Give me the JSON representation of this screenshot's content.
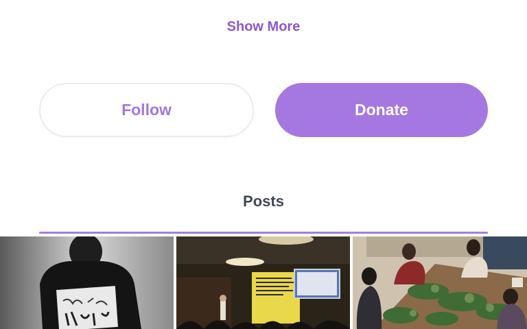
{
  "actions": {
    "show_more_label": "Show More",
    "follow_label": "Follow",
    "donate_label": "Donate"
  },
  "posts": {
    "section_title": "Posts"
  },
  "colors": {
    "accent": "#a577e1",
    "accent_text": "#8a57cf",
    "heading": "#3f4652"
  }
}
